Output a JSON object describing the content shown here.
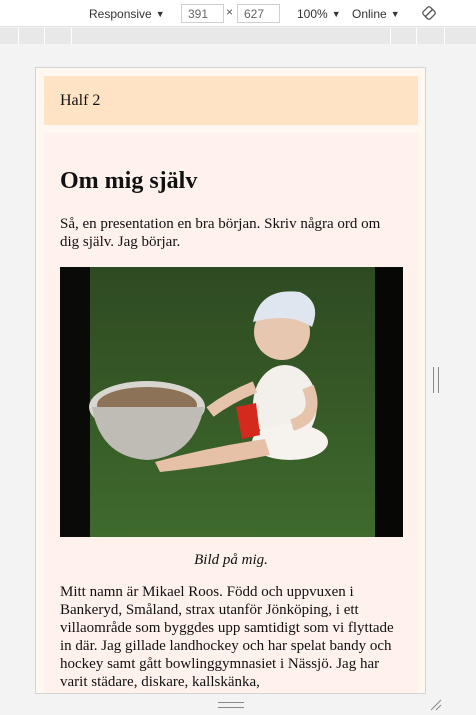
{
  "devtools": {
    "device": "Responsive",
    "width": "391",
    "height": "627",
    "times": "×",
    "zoom": "100%",
    "throttle": "Online"
  },
  "page": {
    "half_label": "Half 2",
    "heading": "Om mig själv",
    "intro": "Så, en presentation en bra början. Skriv några ord om dig själv. Jag börjar.",
    "caption": "Bild på mig.",
    "bio": "Mitt namn är Mikael Roos. Född och uppvuxen i Bankeryd, Småland, strax utanför Jönköping, i ett villaområde som byggdes upp samtidigt som vi flyttade in där. Jag gillade landhockey och har spelat bandy och hockey samt gått bowlinggymnasiet i Nässjö. Jag har varit städare, diskare, kallskänka,"
  },
  "colors": {
    "banner": "#ffe3c4",
    "content_bg": "#fff1ec"
  }
}
